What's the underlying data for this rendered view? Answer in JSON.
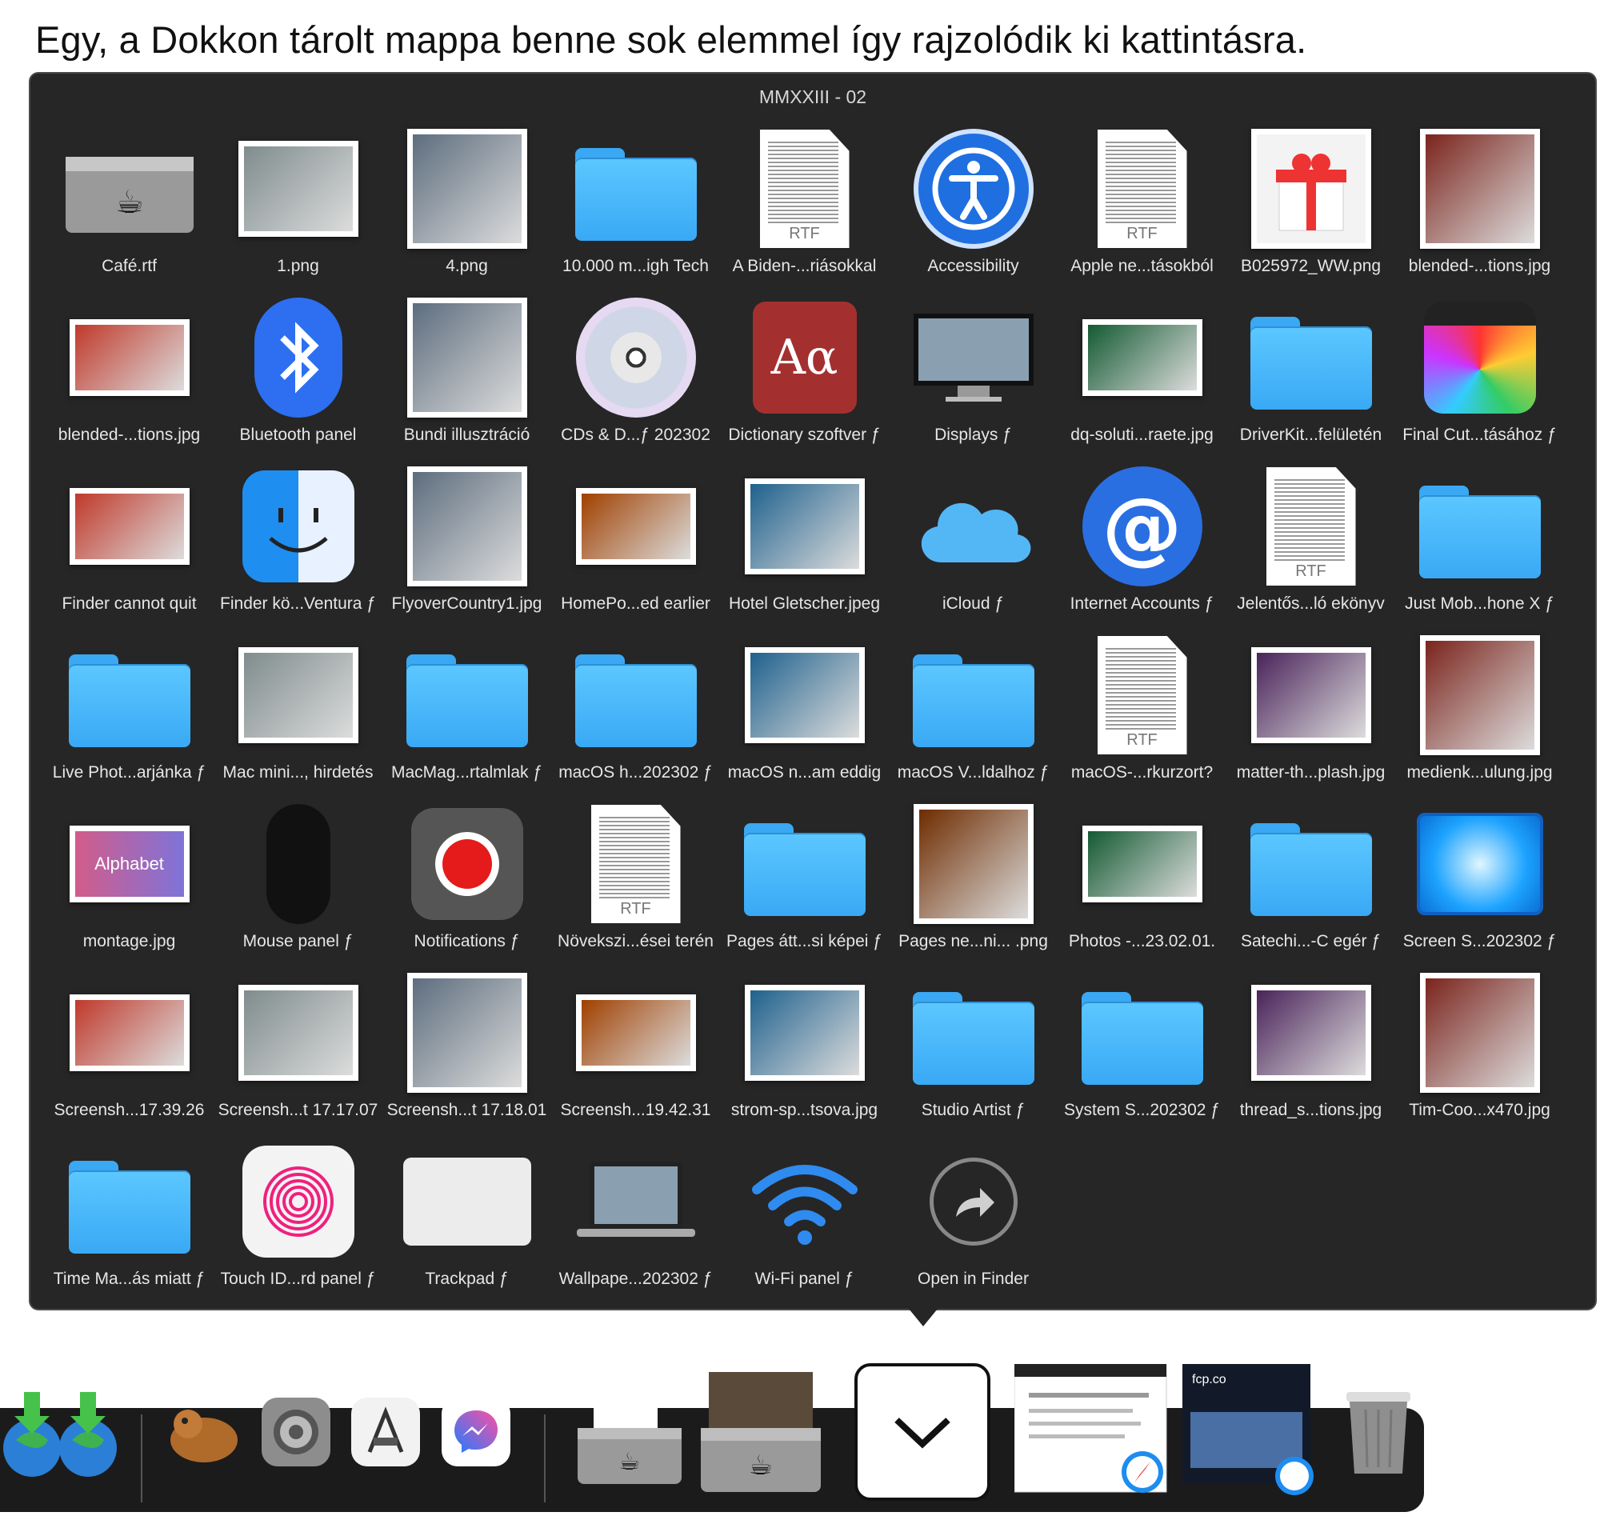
{
  "caption": "Egy, a Dokkon tárolt mappa benne sok elemmel így rajzolódik ki kattintásra.",
  "stack": {
    "title": "MMXXIII - 02",
    "items": [
      {
        "label": "Café.rtf",
        "icon": "tray-icon"
      },
      {
        "label": "1.png",
        "icon": "image-icon"
      },
      {
        "label": "4.png",
        "icon": "image-icon"
      },
      {
        "label": "10.000 m...igh Tech",
        "icon": "folder-icon"
      },
      {
        "label": "A Biden-...riásokkal",
        "icon": "rtf-document-icon"
      },
      {
        "label": "Accessibility",
        "icon": "accessibility-icon"
      },
      {
        "label": "Apple ne...tásokból",
        "icon": "rtf-document-icon"
      },
      {
        "label": "B025972_WW.png",
        "icon": "gift-icon"
      },
      {
        "label": "blended-...tions.jpg",
        "icon": "image-icon"
      },
      {
        "label": "blended-...tions.jpg",
        "icon": "image-icon"
      },
      {
        "label": "Bluetooth panel",
        "icon": "bluetooth-icon"
      },
      {
        "label": "Bundi illusztráció",
        "icon": "image-icon"
      },
      {
        "label": "CDs & D...ƒ 202302",
        "icon": "cd-icon"
      },
      {
        "label": "Dictionary szoftver ƒ",
        "icon": "dictionary-icon"
      },
      {
        "label": "Displays ƒ",
        "icon": "display-icon"
      },
      {
        "label": "dq-soluti...raete.jpg",
        "icon": "image-icon"
      },
      {
        "label": "DriverKit...felületén",
        "icon": "folder-icon"
      },
      {
        "label": "Final Cut...tásához ƒ",
        "icon": "final-cut-icon"
      },
      {
        "label": "Finder cannot quit",
        "icon": "image-icon"
      },
      {
        "label": "Finder kö...Ventura ƒ",
        "icon": "finder-icon"
      },
      {
        "label": "FlyoverCountry1.jpg",
        "icon": "image-icon"
      },
      {
        "label": "HomePo...ed earlier",
        "icon": "image-icon"
      },
      {
        "label": "Hotel Gletscher.jpeg",
        "icon": "image-icon"
      },
      {
        "label": "iCloud ƒ",
        "icon": "icloud-icon"
      },
      {
        "label": "Internet Accounts ƒ",
        "icon": "at-sign-icon"
      },
      {
        "label": "Jelentős...ló ekönyv",
        "icon": "rtf-document-icon"
      },
      {
        "label": "Just Mob...hone X ƒ",
        "icon": "folder-icon"
      },
      {
        "label": "Live Phot...arjánka ƒ",
        "icon": "folder-icon"
      },
      {
        "label": "Mac mini..., hirdetés",
        "icon": "image-icon"
      },
      {
        "label": "MacMag...rtalmlak ƒ",
        "icon": "folder-icon"
      },
      {
        "label": "macOS h...202302 ƒ",
        "icon": "folder-icon"
      },
      {
        "label": "macOS n...am eddig",
        "icon": "image-icon"
      },
      {
        "label": "macOS V...ldalhoz ƒ",
        "icon": "folder-icon"
      },
      {
        "label": "macOS-...rkurzort?",
        "icon": "rtf-document-icon"
      },
      {
        "label": "matter-th...plash.jpg",
        "icon": "image-icon"
      },
      {
        "label": "medienk...ulung.jpg",
        "icon": "image-icon"
      },
      {
        "label": "montage.jpg",
        "icon": "alphabet-image-icon"
      },
      {
        "label": "Mouse panel ƒ",
        "icon": "mouse-icon"
      },
      {
        "label": "Notifications ƒ",
        "icon": "notifications-icon"
      },
      {
        "label": "Növekszi...ései terén",
        "icon": "rtf-document-icon"
      },
      {
        "label": "Pages átt...si képei ƒ",
        "icon": "folder-icon"
      },
      {
        "label": "Pages ne...ni... .png",
        "icon": "image-icon"
      },
      {
        "label": "Photos -...23.02.01.",
        "icon": "image-icon"
      },
      {
        "label": "Satechi...-C egér ƒ",
        "icon": "folder-icon"
      },
      {
        "label": "Screen S...202302 ƒ",
        "icon": "screensaver-icon"
      },
      {
        "label": "Screensh...17.39.26",
        "icon": "image-icon"
      },
      {
        "label": "Screensh...t 17.17.07",
        "icon": "image-icon"
      },
      {
        "label": "Screensh...t 17.18.01",
        "icon": "image-icon"
      },
      {
        "label": "Screensh...19.42.31",
        "icon": "image-icon"
      },
      {
        "label": "strom-sp...tsova.jpg",
        "icon": "image-icon"
      },
      {
        "label": "Studio Artist ƒ",
        "icon": "folder-icon"
      },
      {
        "label": "System S...202302 ƒ",
        "icon": "folder-icon"
      },
      {
        "label": "thread_s...tions.jpg",
        "icon": "image-icon"
      },
      {
        "label": "Tim-Coo...x470.jpg",
        "icon": "image-icon"
      },
      {
        "label": "Time Ma...ás miatt ƒ",
        "icon": "folder-icon"
      },
      {
        "label": "Touch ID...rd panel ƒ",
        "icon": "touch-id-icon"
      },
      {
        "label": "Trackpad ƒ",
        "icon": "trackpad-icon"
      },
      {
        "label": "Wallpape...202302 ƒ",
        "icon": "laptop-icon"
      },
      {
        "label": "Wi-Fi panel ƒ",
        "icon": "wifi-icon"
      },
      {
        "label": "Open in Finder",
        "icon": "open-in-finder-icon"
      }
    ]
  },
  "dock": {
    "items": [
      "downloads-icon",
      "app-icon",
      "system-settings-icon",
      "screen-ruler-icon",
      "messenger-icon",
      "stack-icon",
      "stack-icon",
      "collapse-chevron-icon",
      "safari-window-icon",
      "safari-window-icon",
      "trash-icon"
    ]
  },
  "dock_text": {
    "fcp_window": "fcp.co"
  }
}
